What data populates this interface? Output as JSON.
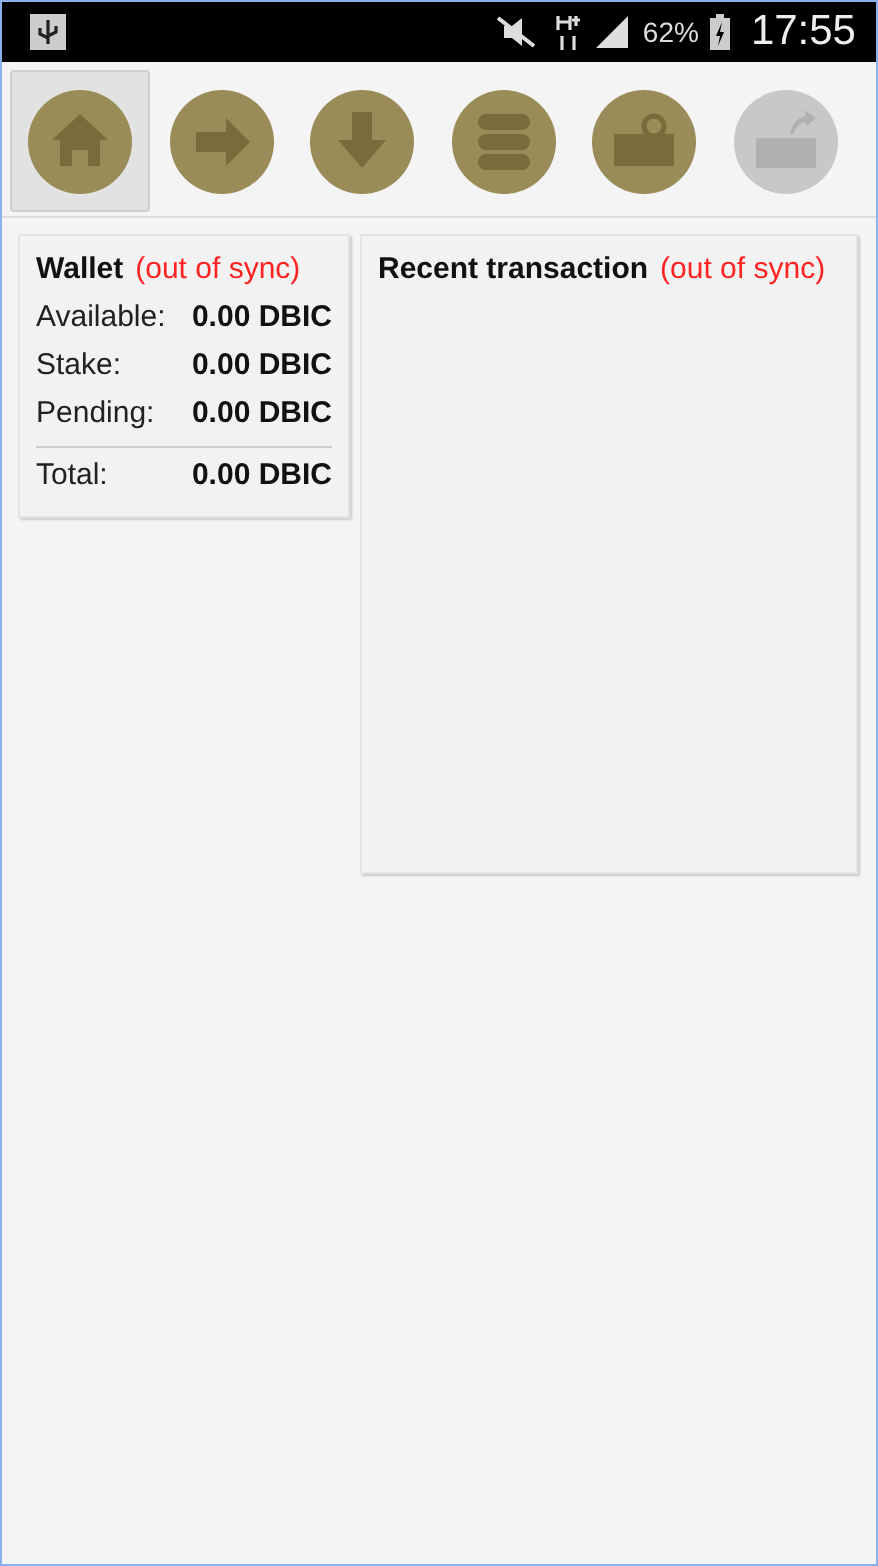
{
  "status_bar": {
    "battery": "62%",
    "time": "17:55"
  },
  "toolbar": [
    {
      "kind": "home",
      "selected": true,
      "disabled": false
    },
    {
      "kind": "send",
      "selected": false,
      "disabled": false
    },
    {
      "kind": "receive",
      "selected": false,
      "disabled": false
    },
    {
      "kind": "list",
      "selected": false,
      "disabled": false
    },
    {
      "kind": "search-mail",
      "selected": false,
      "disabled": false
    },
    {
      "kind": "share-mail",
      "selected": false,
      "disabled": true
    }
  ],
  "wallet": {
    "title": "Wallet",
    "sync": "(out of sync)",
    "rows": [
      {
        "label": "Available:",
        "value": "0.00 DBIC"
      },
      {
        "label": "Stake:",
        "value": "0.00 DBIC"
      },
      {
        "label": "Pending:",
        "value": "0.00 DBIC"
      }
    ],
    "total": {
      "label": "Total:",
      "value": "0.00 DBIC"
    }
  },
  "recent": {
    "title": "Recent transaction",
    "sync": "(out of sync)"
  }
}
